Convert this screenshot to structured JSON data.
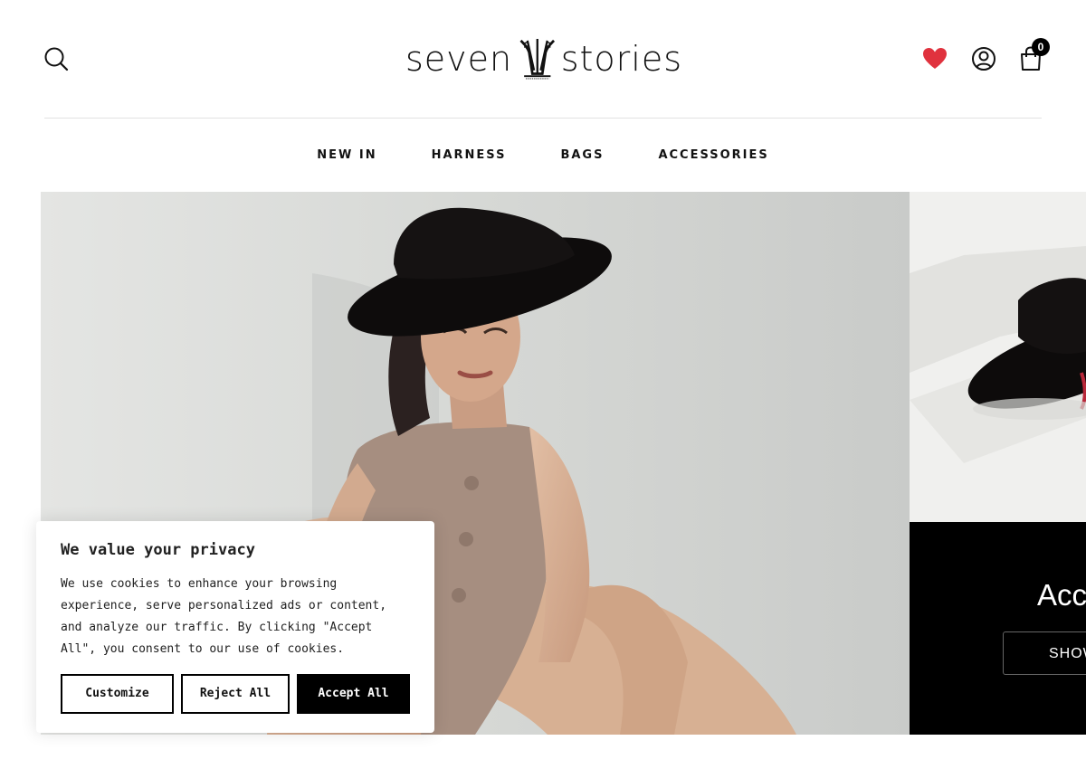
{
  "header": {
    "logo_left": "seven",
    "logo_right": "stories",
    "cart_count": "0",
    "icons": [
      "search-icon",
      "heart-icon",
      "user-icon",
      "shopping-bag-icon"
    ],
    "wishlist_color": "#e0323e"
  },
  "nav": {
    "items": [
      {
        "label": "NEW IN"
      },
      {
        "label": "HARNESS"
      },
      {
        "label": "BAGS"
      },
      {
        "label": "ACCESSORIES"
      }
    ]
  },
  "hero": {
    "promo_title": "Acc",
    "promo_button": "SHOW"
  },
  "cookie_banner": {
    "title": "We value your privacy",
    "body": "We use cookies to enhance your browsing experience, serve personalized ads or content, and analyze our traffic. By clicking \"Accept All\", you consent to our use of cookies.",
    "customize": "Customize",
    "reject": "Reject All",
    "accept": "Accept All"
  }
}
